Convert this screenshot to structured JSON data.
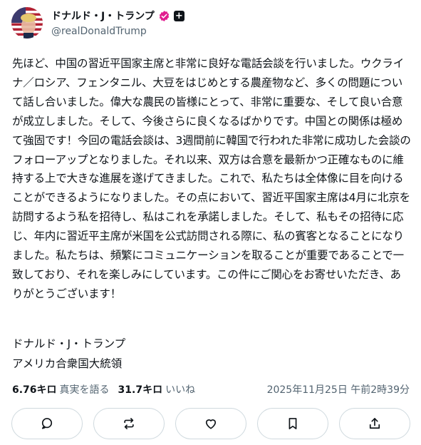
{
  "author": {
    "display_name": "ドナルド・J・トランプ",
    "handle": "@realDonaldTrump",
    "verified_icon": "verified-badge-icon",
    "affiliate_icon": "plus-badge-icon",
    "affiliate_glyph": "+"
  },
  "post": {
    "text": "先ほど、中国の習近平国家主席と非常に良好な電話会談を行いました。ウクライナ／ロシア、フェンタニル、大豆をはじめとする農産物など、多くの問題について話し合いました。偉大な農民の皆様にとって、非常に重要な、そして良い合意が成立しました。そして、今後さらに良くなるばかりです。中国との関係は極めて強固です！今回の電話会談は、3週間前に韓国で行われた非常に成功した会談のフォローアップとなりました。それ以来、双方は合意を最新かつ正確なものに維持する上で大きな進展を遂げてきました。これで、私たちは全体像に目を向けることができるようになりました。その点において、習近平国家主席は4月に北京を訪問するよう私を招待し、私はこれを承諾しました。そして、私もその招待に応じ、年内に習近平主席が米国を公式訪問される際に、私の賓客となることになりました。私たちは、頻繁にコミュニケーションを取ることが重要であることで一致しており、それを楽しみにしています。この件にご関心をお寄せいただき、ありがとうございます！",
    "signature_name": "ドナルド・J・トランプ",
    "signature_title": "アメリカ合衆国大統領"
  },
  "stats": {
    "reposts_count": "6.76キロ",
    "reposts_label": "真実を語る",
    "likes_count": "31.7キロ",
    "likes_label": "いいね",
    "timestamp": "2025年11月25日 午前2時39分"
  },
  "actions": [
    {
      "name": "reply",
      "icon": "comment-icon"
    },
    {
      "name": "repost",
      "icon": "repost-icon"
    },
    {
      "name": "like",
      "icon": "heart-icon"
    },
    {
      "name": "bookmark",
      "icon": "bookmark-icon"
    },
    {
      "name": "share",
      "icon": "share-icon"
    }
  ],
  "colors": {
    "verified_badge": "#e11d8f",
    "secondary_text": "#536471",
    "border": "#cfd9de"
  }
}
